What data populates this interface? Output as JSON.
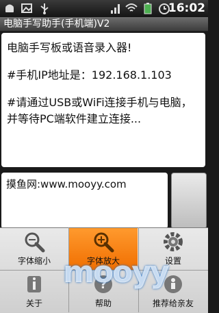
{
  "status_bar": {
    "time": "16:02",
    "icons": [
      "android-icon",
      "image-icon",
      "usb-icon",
      "signal-icon",
      "wifi-icon",
      "battery-icon",
      "alarm-icon"
    ]
  },
  "app": {
    "title": "电脑手写助手(手机端)V2"
  },
  "main_text": {
    "line1": "电脑手写板或语音录入器!",
    "line2": "#手机IP地址是：192.168.1.103",
    "line3": "#请通过USB或WiFi连接手机与电脑，并等待PC端软件建立连接..."
  },
  "input": {
    "value": "摸鱼网:www.mooyy.com"
  },
  "menu": {
    "items": [
      {
        "label": "字体缩小",
        "icon": "zoom-out-icon"
      },
      {
        "label": "字体放大",
        "icon": "zoom-in-icon"
      },
      {
        "label": "设置",
        "icon": "gear-icon"
      },
      {
        "label": "关于",
        "icon": "info-icon"
      },
      {
        "label": "帮助",
        "icon": "help-icon"
      },
      {
        "label": "推荐给亲友",
        "icon": "share-icon"
      }
    ]
  },
  "watermark": {
    "text": "mooyy",
    "sub": "摸鱼网"
  },
  "colors": {
    "accent": "#f06e00",
    "menu_bg": "#dcdcdc",
    "titlebar": "#555555"
  }
}
